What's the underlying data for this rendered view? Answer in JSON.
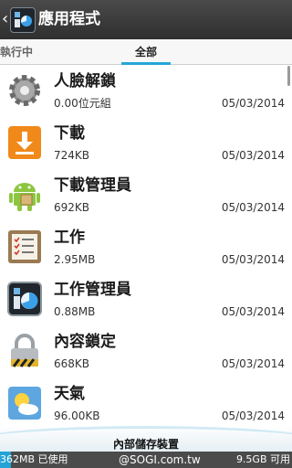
{
  "header": {
    "title": "應用程式",
    "back_icon": "chevron-left-icon",
    "app_icon": "app-manager-icon"
  },
  "tabs": [
    {
      "label": "執行中",
      "selected": false
    },
    {
      "label": "全部",
      "selected": true
    }
  ],
  "apps": [
    {
      "name": "人臉解鎖",
      "size": "0.00位元組",
      "date": "05/03/2014",
      "icon": "gear-icon"
    },
    {
      "name": "下載",
      "size": "724KB",
      "date": "05/03/2014",
      "icon": "download-icon"
    },
    {
      "name": "下載管理員",
      "size": "692KB",
      "date": "05/03/2014",
      "icon": "android-icon"
    },
    {
      "name": "工作",
      "size": "2.95MB",
      "date": "05/03/2014",
      "icon": "task-list-icon"
    },
    {
      "name": "工作管理員",
      "size": "0.88MB",
      "date": "05/03/2014",
      "icon": "task-manager-icon"
    },
    {
      "name": "內容鎖定",
      "size": "668KB",
      "date": "05/03/2014",
      "icon": "padlock-icon"
    },
    {
      "name": "天氣",
      "size": "96.00KB",
      "date": "05/03/2014",
      "icon": "weather-icon"
    }
  ],
  "storage": {
    "label": "內部儲存裝置",
    "used": "362MB 已使用",
    "free": "9.5GB 可用",
    "used_fraction": 0.037,
    "watermark": "@SOGI.com.tw"
  },
  "colors": {
    "accent": "#25a6d8",
    "titlebar": "#3a3a3a",
    "storage_bar": "#4b4b4b"
  }
}
